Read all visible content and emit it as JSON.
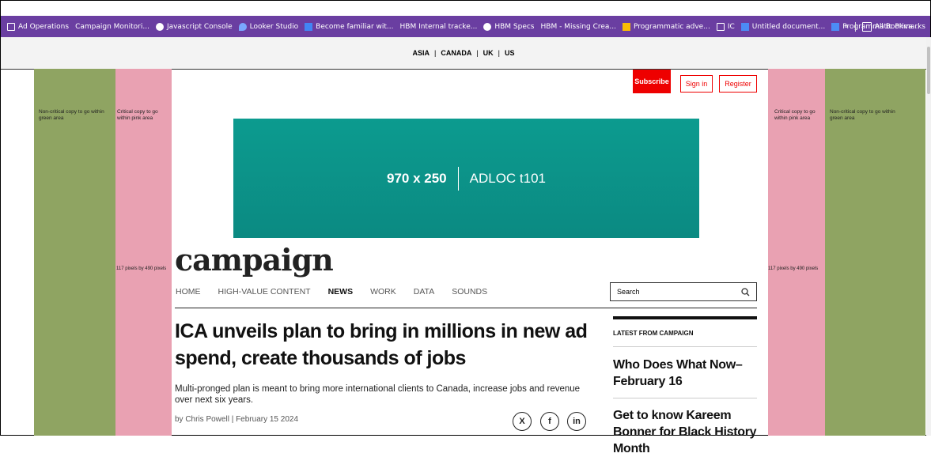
{
  "bookmarks": {
    "items": [
      {
        "label": "Ad Operations",
        "icon": "folder-icon"
      },
      {
        "label": "Campaign Monitori...",
        "icon": "sheets-icon"
      },
      {
        "label": "Javascript Console",
        "icon": "globe-icon"
      },
      {
        "label": "Looker Studio",
        "icon": "looker-icon"
      },
      {
        "label": "Become familiar wit...",
        "icon": "bookmark-icon"
      },
      {
        "label": "HBM Internal tracke...",
        "icon": "sheets-icon"
      },
      {
        "label": "HBM Specs",
        "icon": "globe-icon"
      },
      {
        "label": "HBM - Missing Crea...",
        "icon": "sheets-icon"
      },
      {
        "label": "Programmatic adve...",
        "icon": "slides-icon"
      },
      {
        "label": "IC",
        "icon": "folder-icon"
      },
      {
        "label": "Untitled document...",
        "icon": "docs-icon"
      },
      {
        "label": "Programmatic Priva...",
        "icon": "docs-icon"
      }
    ],
    "overflow": "»",
    "all_bookmarks": "All Bookmarks"
  },
  "regions": [
    "ASIA",
    "CANADA",
    "UK",
    "US"
  ],
  "region_sep": "|",
  "side": {
    "green_text": "Non-critical copy to go within green area",
    "pink_text": "Critical copy to go within pink area",
    "pink_size": "117 pixels by 490 pixels"
  },
  "header": {
    "subscribe": "Subscribe",
    "sign_in": "Sign in",
    "register": "Register"
  },
  "ad": {
    "size": "970 x 250",
    "loc": "ADLOC t101"
  },
  "logo": "campaign",
  "nav": {
    "items": [
      "HOME",
      "HIGH-VALUE CONTENT",
      "NEWS",
      "WORK",
      "DATA",
      "SOUNDS"
    ],
    "active": "NEWS"
  },
  "search": {
    "placeholder": "Search",
    "icon": "search-icon"
  },
  "article": {
    "headline": "ICA unveils plan to bring in millions in new ad spend, create thousands of jobs",
    "standfirst": "Multi-pronged plan is meant to bring more international clients to Canada, increase jobs and revenue over next six years.",
    "byline": "by Chris Powell | February 15 2024"
  },
  "social": [
    "X",
    "f",
    "in"
  ],
  "sidebar": {
    "title": "LATEST FROM CAMPAIGN",
    "stories": [
      "Who Does What Now– February 16",
      "Get to know Kareem Bonner for Black History Month"
    ]
  },
  "colors": {
    "bookmark_bar": "#6a3ea1",
    "green_panel": "#8fa462",
    "pink_panel": "#e9a1b2",
    "ad_teal": "#0c9b8f",
    "accent_red": "#e00000"
  }
}
